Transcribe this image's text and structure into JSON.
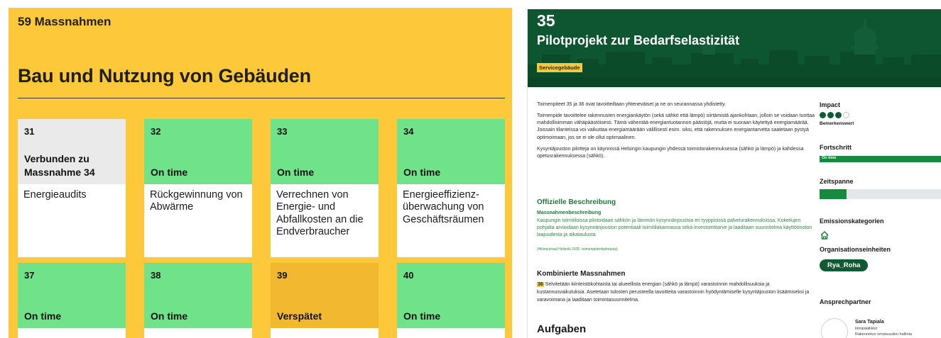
{
  "left": {
    "count_label": "59 Massnahmen",
    "section_title": "Bau und Nutzung von Gebäuden",
    "cards": [
      {
        "number": "31",
        "status": "Verbunden zu Massnahme 34",
        "name": "Energieaudits",
        "status_color": "#eaeaea"
      },
      {
        "number": "32",
        "status": "On time",
        "name": "Rückgewinnung von Abwärme",
        "status_color": "#6fe28a"
      },
      {
        "number": "33",
        "status": "On time",
        "name": "Verrechnen von Energie- und Abfallkosten an die Endverbraucher",
        "status_color": "#6fe28a"
      },
      {
        "number": "34",
        "status": "On time",
        "name": "Energieeffizienz-überwachung von Geschäftsräumen",
        "status_color": "#6fe28a"
      },
      {
        "number": "37",
        "status": "On time",
        "name": "",
        "status_color": "#6fe28a"
      },
      {
        "number": "38",
        "status": "On time",
        "name": "",
        "status_color": "#6fe28a"
      },
      {
        "number": "39",
        "status": "Verspätet",
        "name": "",
        "status_color": "#f2b830"
      },
      {
        "number": "40",
        "status": "On time",
        "name": "",
        "status_color": "#6fe28a"
      }
    ]
  },
  "detail": {
    "number": "35",
    "title": "Pilotprojekt zur Bedarfselastizität",
    "category_badge": "Servicegebäude",
    "paragraphs": [
      "Toimenpiteet 35 ja 36 ovat tavoitteiltaan yhteneväiset ja ne on seurannassa yhdistetty.",
      "Toimenpide tavoittelee rakennusten energiankäytön (sekä sähkö että lämpö) siirtämistä ajankohtaan, jolloin se voidaan tuottaa mahdollisimman vähäpäästöisesti. Tämä vähentää energiantuotannon päästöjä, mutta ei suoraan käytettyä energiamäärää. Joissain tilanteissa voi vaikuttaa energiamäärään välillisesti esim. siksi, että rakennuksen energiantarvetta saatetaan pystyä optimoimaan, jos se ei ole ollut optimaalinen.",
      "Kysyntäjouston pilotteja on käynnissä Helsingin kaupungin yhdessä toimistorakennuksessa (sähkö ja lämpö) ja kahdessa opetusrakennuksessa (sähkö)."
    ],
    "official_heading": "Offizielle Beschreibung",
    "official_subheading": "Massnahmenbeschreibung",
    "official_text": "Kaupungin toimitiloissa pilotoidaan sähkön ja lämmön kysynnänjoustoa eri tyyppisissä palvelurakennuksissa. Kokeilujen pohjalta arvioidaan kysynnänjouston potentiaali toimitilakannassa sekä investointitarve ja laaditaan suunnitelma käyttöönoton laajuudesta ja aikataulusta.",
    "official_source": "(Hiilineutraali Helsinki 2035 -toimenpideohjelmasta)",
    "combined_heading": "Kombinierte Massnahmen",
    "combined_tag": "36",
    "combined_text": "Selvitetään kiinteistökohtaista tai alueellista energian (sähkö ja lämpö) varastoinnin mahdollisuuksia ja kustannusvaikutuksia. Asetetaan tulosten perusteella tavoitteita varastoinnin hyödyntämiselle kysyntäjouston lisäämiseksi ja varavoimana ja laaditaan toimintasuunnitelma.",
    "tasks_heading": "Aufgaben"
  },
  "sidebar": {
    "impact_label": "Impact",
    "impact_level": 3,
    "impact_max": 4,
    "impact_text": "Bemerkenswert",
    "progress_label": "Fortschritt",
    "progress_status": "On time",
    "progress_fraction": 1.0,
    "timespan_label": "Zeitspanne",
    "timespan_fraction": 0.22,
    "emission_label": "Emissionskategorien",
    "emission_icon": "house-icon",
    "org_label": "Organisationseinheiten",
    "org_unit": "Rya_Roha",
    "contact_label": "Ansprechpartner",
    "contact_name": "Sara Tapiala",
    "contact_role": "tiimipäällikkö",
    "contact_org": "Rakennetun omaisuuden hallinta"
  },
  "colors": {
    "yellow": "#fdc93a",
    "green_status": "#6fe28a",
    "orange_status": "#f2b830",
    "dark_green": "#0f5a34",
    "official_green": "#1f7a3a"
  }
}
